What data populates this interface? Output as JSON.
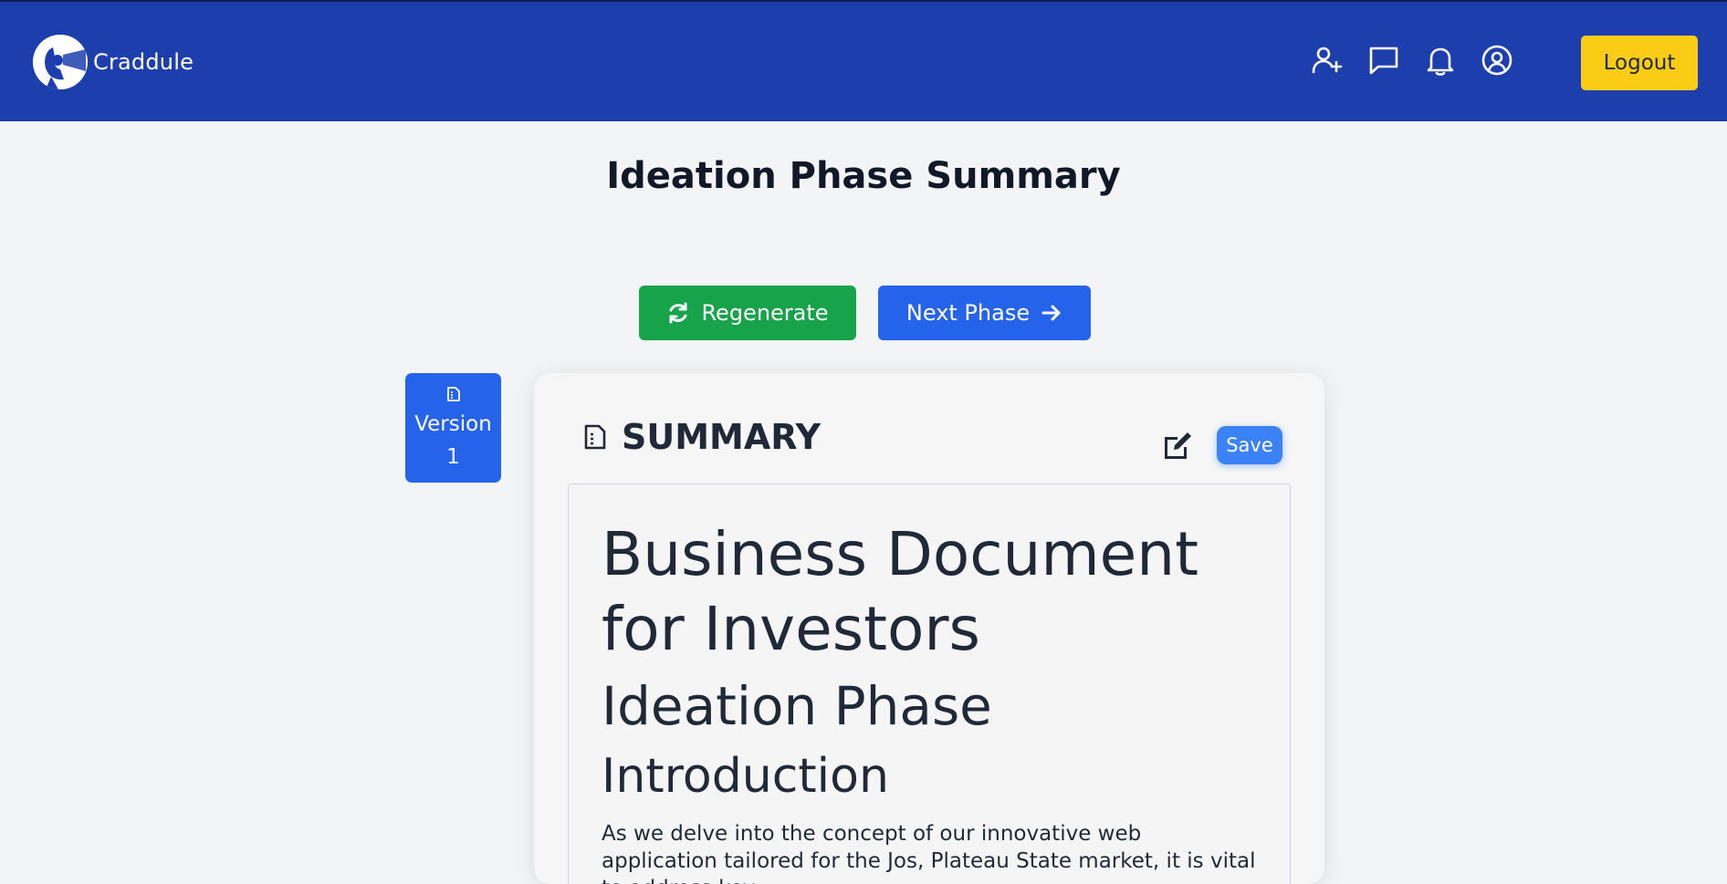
{
  "header": {
    "brand_name": "Craddule",
    "icons": [
      "add-user-icon",
      "chat-icon",
      "bell-icon",
      "account-icon"
    ],
    "logout_label": "Logout",
    "colors": {
      "bar": "#1d3fae",
      "logout": "#facc15"
    }
  },
  "page": {
    "title": "Ideation Phase Summary"
  },
  "actions": {
    "regenerate_label": "Regenerate",
    "next_phase_label": "Next Phase",
    "colors": {
      "regenerate": "#16a34a",
      "next": "#2563eb"
    }
  },
  "versions": {
    "label_line1": "Version",
    "label_line2": "1"
  },
  "summary": {
    "heading": "SUMMARY",
    "save_label": "Save",
    "document": {
      "h1": "Business Document for Investors",
      "h2": "Ideation Phase",
      "h3": "Introduction",
      "paragraph": "As we delve into the concept of our innovative web application tailored for the Jos, Plateau State market, it is vital to address key"
    }
  }
}
